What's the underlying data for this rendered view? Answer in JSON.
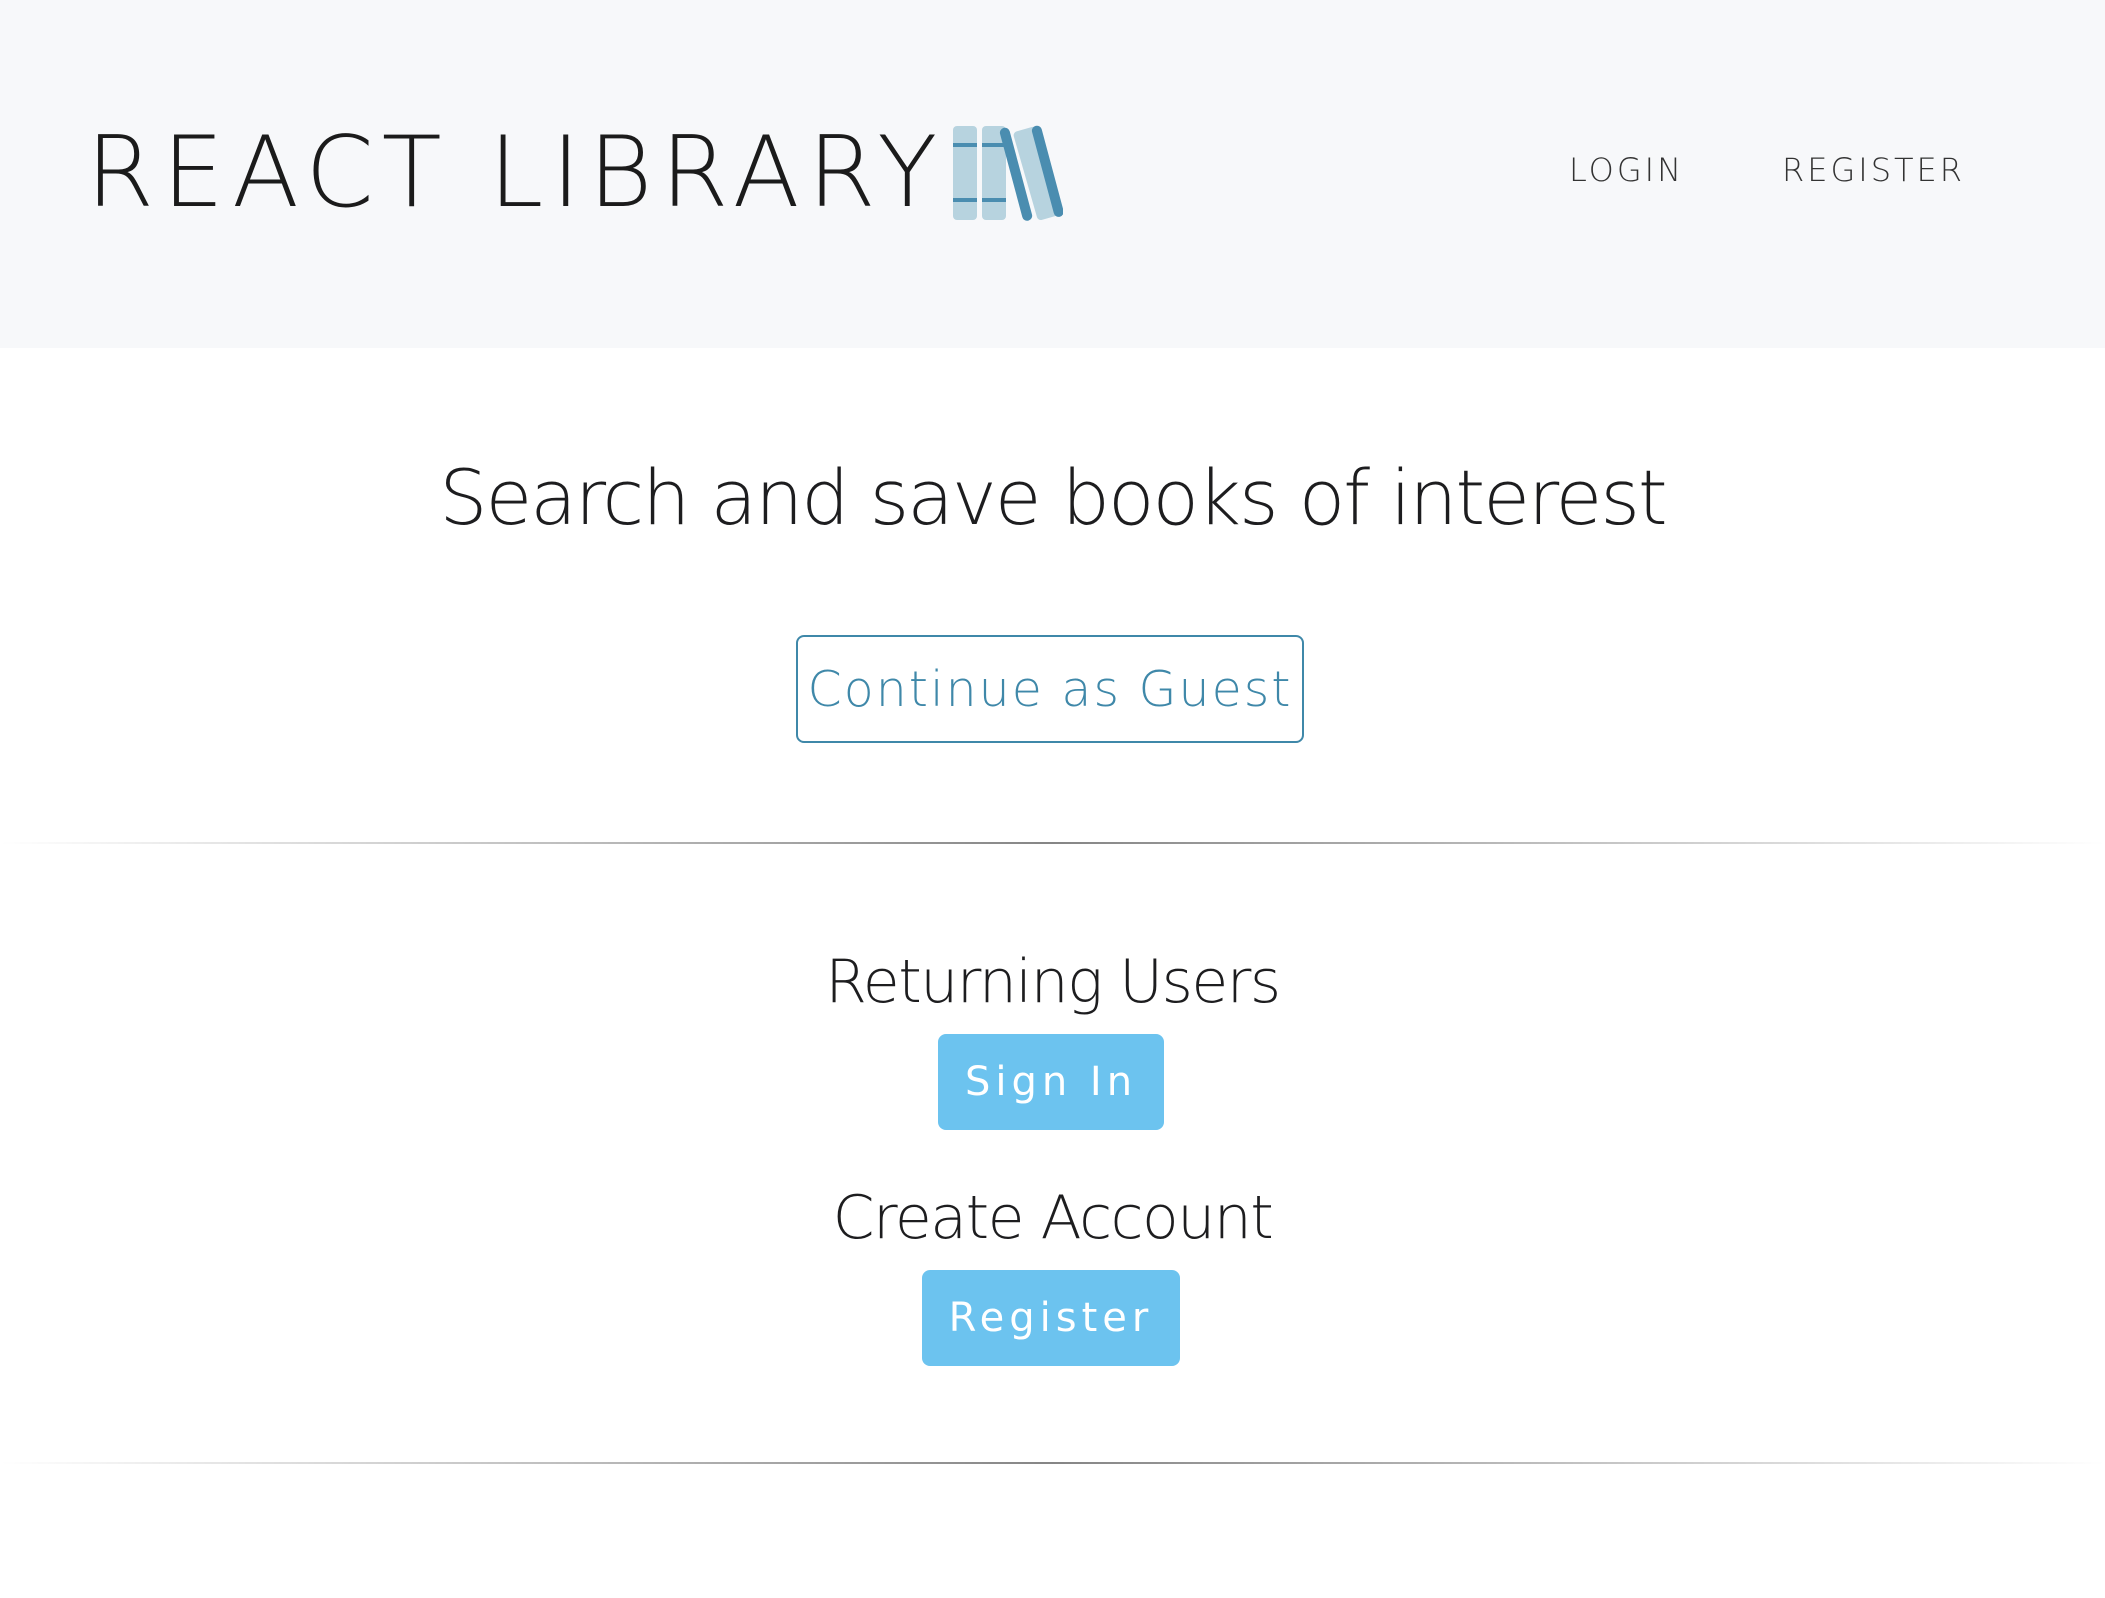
{
  "header": {
    "brand": "REACT LIBRARY",
    "logo_icon": "books-icon",
    "nav": {
      "login": "LOGIN",
      "register": "REGISTER"
    }
  },
  "main": {
    "headline": "Search and save books of interest",
    "guest_button": "Continue as Guest",
    "returning_title": "Returning Users",
    "signin_button": "Sign In",
    "create_title": "Create Account",
    "register_button": "Register"
  },
  "colors": {
    "navbar_bg": "#f7f8fa",
    "accent_outline": "#3f88a9",
    "button_fill": "#6cc3ef",
    "logo_light": "#b7d3df",
    "logo_dark": "#4a8db0"
  }
}
